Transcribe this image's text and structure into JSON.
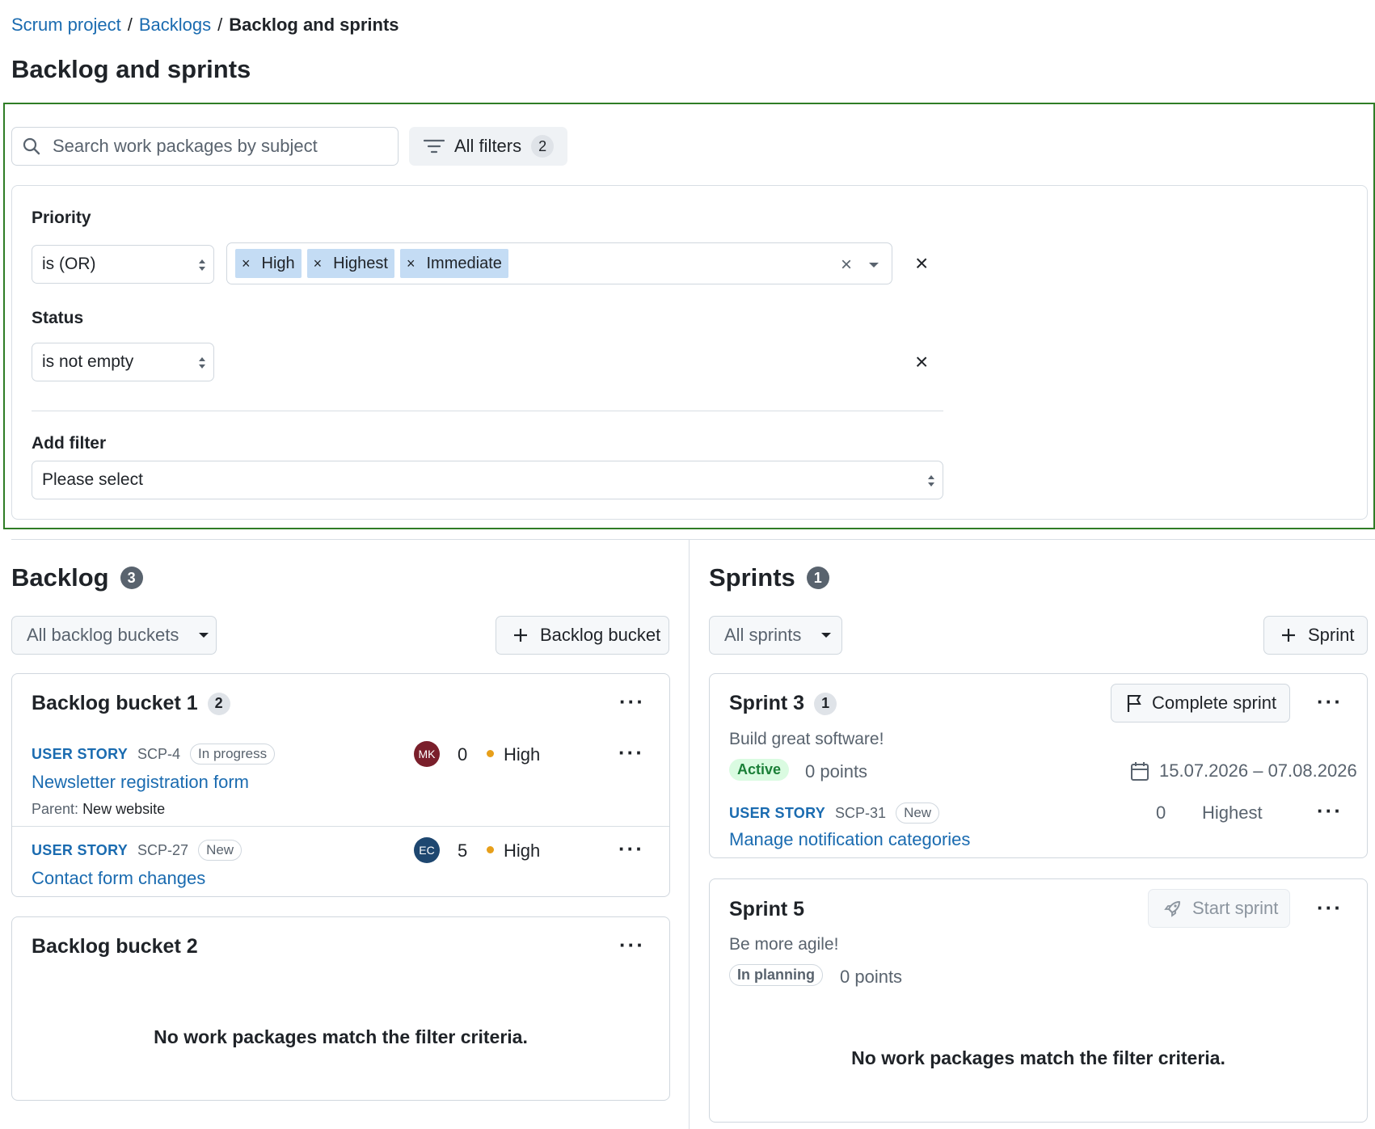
{
  "breadcrumb": {
    "project": "Scrum project",
    "sep": "/",
    "section": "Backlogs",
    "current": "Backlog and sprints"
  },
  "page_title": "Backlog and sprints",
  "search": {
    "placeholder": "Search work packages by subject"
  },
  "all_filters": {
    "label": "All filters",
    "count": "2"
  },
  "filters": {
    "priority": {
      "label": "Priority",
      "operator": "is (OR)",
      "values": [
        "High",
        "Highest",
        "Immediate"
      ]
    },
    "status": {
      "label": "Status",
      "operator": "is not empty"
    },
    "add_filter": {
      "label": "Add filter",
      "placeholder": "Please select"
    }
  },
  "backlog": {
    "title": "Backlog",
    "count": "3",
    "bucket_select": "All backlog buckets",
    "add_button": "Backlog bucket",
    "buckets": [
      {
        "title": "Backlog bucket 1",
        "count": "2",
        "items": [
          {
            "type": "USER STORY",
            "id": "SCP-4",
            "status": "In progress",
            "subject": "Newsletter registration form",
            "parent_label": "Parent:",
            "parent": "New website",
            "avatar": "MK",
            "points": "0",
            "priority": "High"
          },
          {
            "type": "USER STORY",
            "id": "SCP-27",
            "status": "New",
            "subject": "Contact form changes",
            "avatar": "EC",
            "points": "5",
            "priority": "High"
          }
        ]
      },
      {
        "title": "Backlog bucket 2",
        "empty": "No work packages match the filter criteria."
      }
    ]
  },
  "sprints": {
    "title": "Sprints",
    "count": "1",
    "sprint_select": "All sprints",
    "add_button": "Sprint",
    "list": [
      {
        "title": "Sprint 3",
        "count": "1",
        "action": "Complete sprint",
        "description": "Build great software!",
        "state": "Active",
        "points": "0 points",
        "dates": "15.07.2026 – 07.08.2026",
        "items": [
          {
            "type": "USER STORY",
            "id": "SCP-31",
            "status": "New",
            "subject": "Manage notification categories",
            "points": "0",
            "priority": "Highest"
          }
        ]
      },
      {
        "title": "Sprint 5",
        "action": "Start sprint",
        "description": "Be more agile!",
        "state": "In planning",
        "points": "0 points",
        "empty": "No work packages match the filter criteria."
      }
    ]
  },
  "colors": {
    "accent_link": "#1a6bb0",
    "filter_frame": "#2f7d26",
    "chip_bg": "#c4dcf4",
    "avatar_mk": "#7a1f2b",
    "avatar_ec": "#1e4770",
    "priority_dot": "#e79f1a",
    "active_badge": "#dafbe1"
  }
}
